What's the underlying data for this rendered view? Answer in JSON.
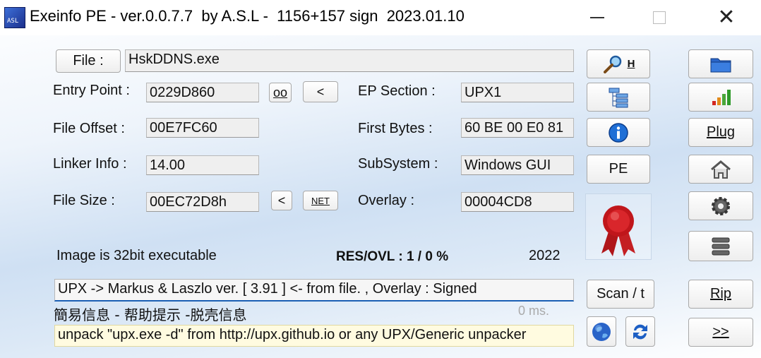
{
  "window": {
    "title": "Exeinfo PE - ver.0.0.7.7  by A.S.L -  1156+157 sign  2023.01.10",
    "icon_text": "ASL"
  },
  "file": {
    "button_label": "File :",
    "value": "HskDDNS.exe"
  },
  "fields": {
    "entry_point_label": "Entry Point :",
    "entry_point_value": "0229D860",
    "oo_label": "oo",
    "lt_label": "<",
    "file_offset_label": "File Offset :",
    "file_offset_value": "00E7FC60",
    "linker_info_label": "Linker Info :",
    "linker_info_value": "14.00",
    "file_size_label": "File Size :",
    "file_size_value": "00EC72D8h",
    "size_lt_label": "<",
    "net_label": "NET",
    "ep_section_label": "EP Section :",
    "ep_section_value": "UPX1",
    "first_bytes_label": "First Bytes :",
    "first_bytes_value": "60 BE 00 E0 81",
    "subsystem_label": "SubSystem :",
    "subsystem_value": "Windows GUI",
    "overlay_label": "Overlay :",
    "overlay_value": "00004CD8"
  },
  "info": {
    "image_type": "Image is 32bit executable",
    "res_ovl": "RES/OVL : 1 / 0 %",
    "year": "2022"
  },
  "detection": {
    "result": "UPX -> Markus & Laszlo ver. [ 3.91 ] <- from file. , Overlay :  Signed",
    "chinese_info": "簡易信息 - 帮助提示 -脱壳信息",
    "time": "0 ms.",
    "hint": "unpack \"upx.exe -d\"  from  http://upx.github.io or any UPX/Generic unpacker"
  },
  "mid_buttons": {
    "h_label": "H",
    "pe_label": "PE",
    "scan_label": "Scan / t"
  },
  "right_buttons": {
    "plug_label": "Plug",
    "rip_label": "Rip",
    "next_label": ">>"
  },
  "colors": {
    "accent_blue": "#1a5fb4",
    "ribbon_red": "#c0161b",
    "field_bg": "#efefef"
  }
}
